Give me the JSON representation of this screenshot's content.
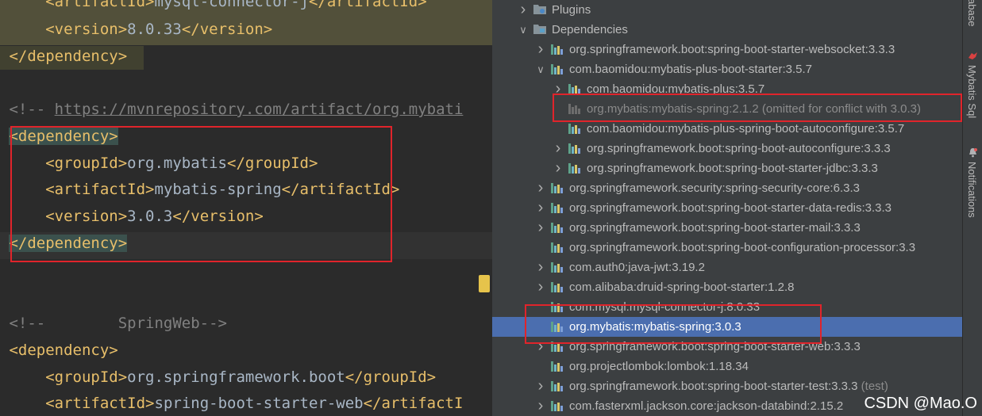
{
  "editor": {
    "lines": [
      {
        "indent": "    ",
        "open": "<artifactId>",
        "text": "mysql-connector-j",
        "close": "</artifactId>"
      },
      {
        "indent": "    ",
        "open": "<version>",
        "text": "8.0.33",
        "close": "</version>"
      },
      {
        "indent": "",
        "open": "</dependency>",
        "text": "",
        "close": ""
      },
      {
        "comment_prefix": "<!-- ",
        "comment_url": "https://mvnrepository.com/artifact/org.mybati"
      },
      {
        "indent": "",
        "open": "<dependency>",
        "text": "",
        "close": ""
      },
      {
        "indent": "    ",
        "open": "<groupId>",
        "text": "org.mybatis",
        "close": "</groupId>"
      },
      {
        "indent": "    ",
        "open": "<artifactId>",
        "text": "mybatis-spring",
        "close": "</artifactId>"
      },
      {
        "indent": "    ",
        "open": "<version>",
        "text": "3.0.3",
        "close": "</version>"
      },
      {
        "indent": "",
        "open": "</dependency>",
        "text": "",
        "close": ""
      },
      {
        "comment_full": "<!--        SpringWeb-->"
      },
      {
        "indent": "",
        "open": "<dependency>",
        "text": "",
        "close": ""
      },
      {
        "indent": "    ",
        "open": "<groupId>",
        "text": "org.springframework.boot",
        "close": "</groupId>"
      },
      {
        "indent": "    ",
        "open": "<artifactId>",
        "text": "spring-boot-starter-web",
        "close": "</artifactI"
      }
    ]
  },
  "maven_tree": {
    "rows": [
      {
        "label": "Plugins",
        "suffix": "",
        "icon": "folder-icon",
        "chevron": "right",
        "selected": false,
        "omitted": false
      },
      {
        "label": "Dependencies",
        "suffix": "",
        "icon": "folder-icon",
        "chevron": "down",
        "selected": false,
        "omitted": false
      },
      {
        "label": "org.springframework.boot:spring-boot-starter-websocket:3.3.3",
        "suffix": "",
        "icon": "dependency-icon",
        "chevron": "right",
        "selected": false,
        "omitted": false
      },
      {
        "label": "com.baomidou:mybatis-plus-boot-starter:3.5.7",
        "suffix": "",
        "icon": "dependency-icon",
        "chevron": "down",
        "selected": false,
        "omitted": false
      },
      {
        "label": "com.baomidou:mybatis-plus:3.5.7",
        "suffix": "",
        "icon": "dependency-icon",
        "chevron": "right",
        "selected": false,
        "omitted": false
      },
      {
        "label": "org.mybatis:mybatis-spring:2.1.2",
        "suffix": " (omitted for conflict with 3.0.3)",
        "icon": "dependency-icon",
        "chevron": "none",
        "selected": false,
        "omitted": true
      },
      {
        "label": "com.baomidou:mybatis-plus-spring-boot-autoconfigure:3.5.7",
        "suffix": "",
        "icon": "dependency-icon",
        "chevron": "none",
        "selected": false,
        "omitted": false
      },
      {
        "label": "org.springframework.boot:spring-boot-autoconfigure:3.3.3",
        "suffix": "",
        "icon": "dependency-icon",
        "chevron": "right",
        "selected": false,
        "omitted": false
      },
      {
        "label": "org.springframework.boot:spring-boot-starter-jdbc:3.3.3",
        "suffix": "",
        "icon": "dependency-icon",
        "chevron": "right",
        "selected": false,
        "omitted": false
      },
      {
        "label": "org.springframework.security:spring-security-core:6.3.3",
        "suffix": "",
        "icon": "dependency-icon",
        "chevron": "right",
        "selected": false,
        "omitted": false
      },
      {
        "label": "org.springframework.boot:spring-boot-starter-data-redis:3.3.3",
        "suffix": "",
        "icon": "dependency-icon",
        "chevron": "right",
        "selected": false,
        "omitted": false
      },
      {
        "label": "org.springframework.boot:spring-boot-starter-mail:3.3.3",
        "suffix": "",
        "icon": "dependency-icon",
        "chevron": "right",
        "selected": false,
        "omitted": false
      },
      {
        "label": "org.springframework.boot:spring-boot-configuration-processor:3.3",
        "suffix": "",
        "icon": "dependency-icon",
        "chevron": "none",
        "selected": false,
        "omitted": false
      },
      {
        "label": "com.auth0:java-jwt:3.19.2",
        "suffix": "",
        "icon": "dependency-icon",
        "chevron": "right",
        "selected": false,
        "omitted": false
      },
      {
        "label": "com.alibaba:druid-spring-boot-starter:1.2.8",
        "suffix": "",
        "icon": "dependency-icon",
        "chevron": "right",
        "selected": false,
        "omitted": false
      },
      {
        "label": "com.mysql:mysql-connector-j:8.0.33",
        "suffix": "",
        "icon": "dependency-icon",
        "chevron": "none",
        "selected": false,
        "omitted": false
      },
      {
        "label": "org.mybatis:mybatis-spring:3.0.3",
        "suffix": "",
        "icon": "dependency-icon",
        "chevron": "none",
        "selected": true,
        "omitted": false
      },
      {
        "label": "org.springframework.boot:spring-boot-starter-web:3.3.3",
        "suffix": "",
        "icon": "dependency-icon",
        "chevron": "right",
        "selected": false,
        "omitted": false
      },
      {
        "label": "org.projectlombok:lombok:1.18.34",
        "suffix": "",
        "icon": "dependency-icon",
        "chevron": "none",
        "selected": false,
        "omitted": false
      },
      {
        "label": "org.springframework.boot:spring-boot-starter-test:3.3.3",
        "suffix": " (test)",
        "icon": "dependency-icon",
        "chevron": "right",
        "selected": false,
        "omitted": false
      },
      {
        "label": "com.fasterxml.jackson.core:jackson-databind:2.15.2",
        "suffix": "",
        "icon": "dependency-icon",
        "chevron": "right",
        "selected": false,
        "omitted": false
      }
    ]
  },
  "right_strip": {
    "database_label": "abase",
    "mybatis_label": "Mybatis Sql",
    "notifications_label": "Notifications"
  },
  "watermark": "CSDN @Mao.O",
  "colors": {
    "tag": "#e8bf6a",
    "text": "#a9b7c6",
    "comment": "#808080",
    "selection": "#4b6eaf",
    "annotation_box": "#e0242b"
  }
}
